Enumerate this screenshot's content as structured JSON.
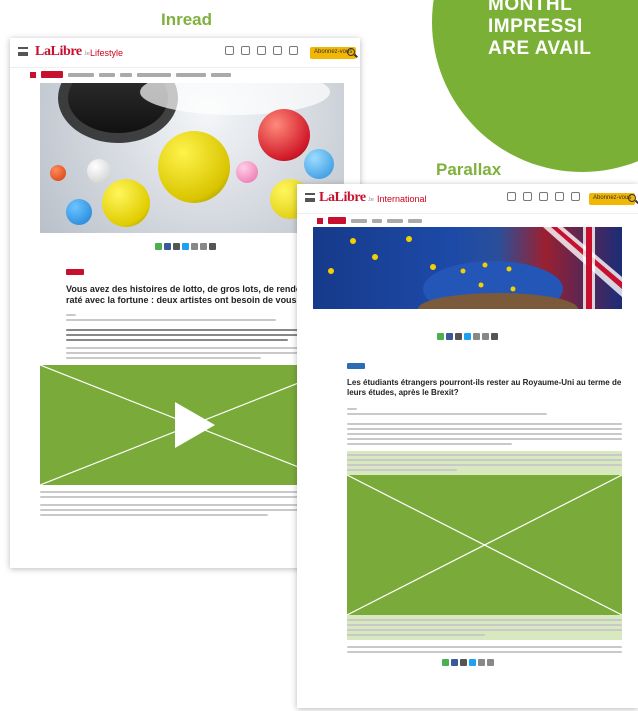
{
  "labels": {
    "inread": "Inread",
    "parallax": "Parallax"
  },
  "badge": {
    "lines": [
      "MONTHL",
      "IMPRESSI",
      "ARE AVAIL"
    ]
  },
  "inread_page": {
    "logo": "LaLibre",
    "logo_suffix": ".be",
    "section": "Lifestyle",
    "subscribe_label": "Abonnez-vous",
    "headline": "Vous avez des histoires de lotto, de gros lots, de rendez-vous raté avec la fortune : deux artistes ont besoin de vous",
    "icons": [
      "menu-icon",
      "search-icon",
      "play-icon"
    ]
  },
  "parallax_page": {
    "logo": "LaLibre",
    "logo_suffix": ".be",
    "section": "International",
    "subscribe_label": "Abonnez-vous",
    "headline": "Les étudiants étrangers pourront-ils rester au Royaume-Uni au terme de leurs études, après le Brexit?",
    "icons": [
      "menu-icon",
      "search-icon"
    ]
  },
  "colors": {
    "brand_green": "#7ab035",
    "video_green": "#7aab3a",
    "brand_red": "#c8102e",
    "subscribe_yellow": "#f2b705",
    "parallax_highlight": "#d8e8bf"
  }
}
